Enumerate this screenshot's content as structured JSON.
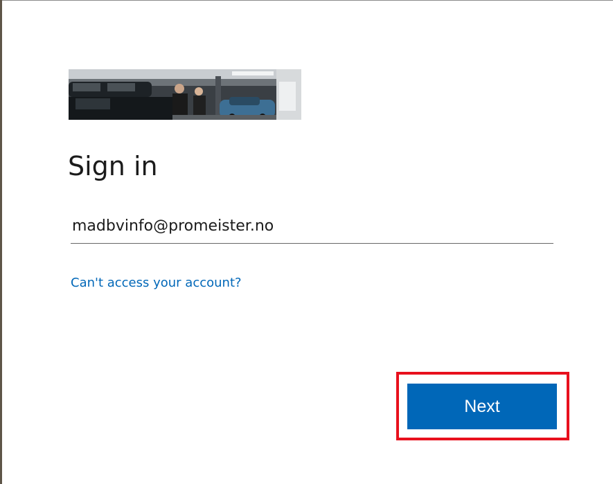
{
  "banner": {
    "icon": "garage-mechanics-photo-banner"
  },
  "signin": {
    "title": "Sign in",
    "email_value": "madbvinfo@promeister.no",
    "help_link": "Can't access your account?",
    "next_label": "Next"
  },
  "colors": {
    "accent": "#0067b8",
    "link": "#0067b8",
    "highlight": "#e8101d",
    "text": "#1b1b1b"
  }
}
